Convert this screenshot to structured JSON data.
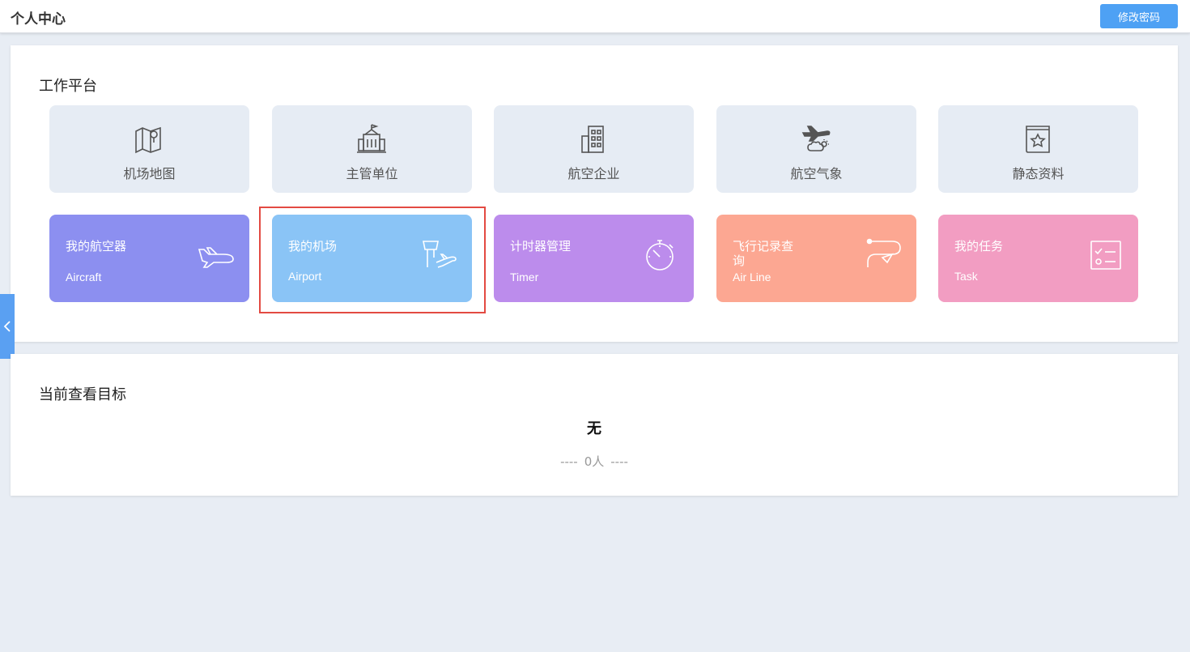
{
  "header": {
    "title": "个人中心",
    "change_password": "修改密码"
  },
  "workbench": {
    "title": "工作平台",
    "quick_links": [
      {
        "label": "机场地图",
        "icon": "map-icon"
      },
      {
        "label": "主管单位",
        "icon": "government-building-icon"
      },
      {
        "label": "航空企业",
        "icon": "office-building-icon"
      },
      {
        "label": "航空气象",
        "icon": "plane-weather-icon"
      },
      {
        "label": "静态资料",
        "icon": "star-book-icon"
      }
    ],
    "cards": [
      {
        "title": "我的航空器",
        "sub": "Aircraft",
        "color": "#8c8ff0",
        "icon": "airplane-icon"
      },
      {
        "title": "我的机场",
        "sub": "Airport",
        "color": "#8ac4f6",
        "icon": "control-tower-icon"
      },
      {
        "title": "计时器管理",
        "sub": "Timer",
        "color": "#bc8cec",
        "icon": "stopwatch-icon"
      },
      {
        "title": "飞行记录查询",
        "sub": "Air Line",
        "color": "#fca792",
        "icon": "flight-path-icon"
      },
      {
        "title": "我的任务",
        "sub": "Task",
        "color": "#f29dc2",
        "icon": "checklist-icon"
      }
    ]
  },
  "target": {
    "title": "当前查看目标",
    "name": "无",
    "dash_left": "----",
    "count": "0人",
    "dash_right": "----"
  },
  "colors": {
    "accent": "#4ea1f4",
    "highlight": "#e34a42",
    "background": "#e8edf4"
  }
}
